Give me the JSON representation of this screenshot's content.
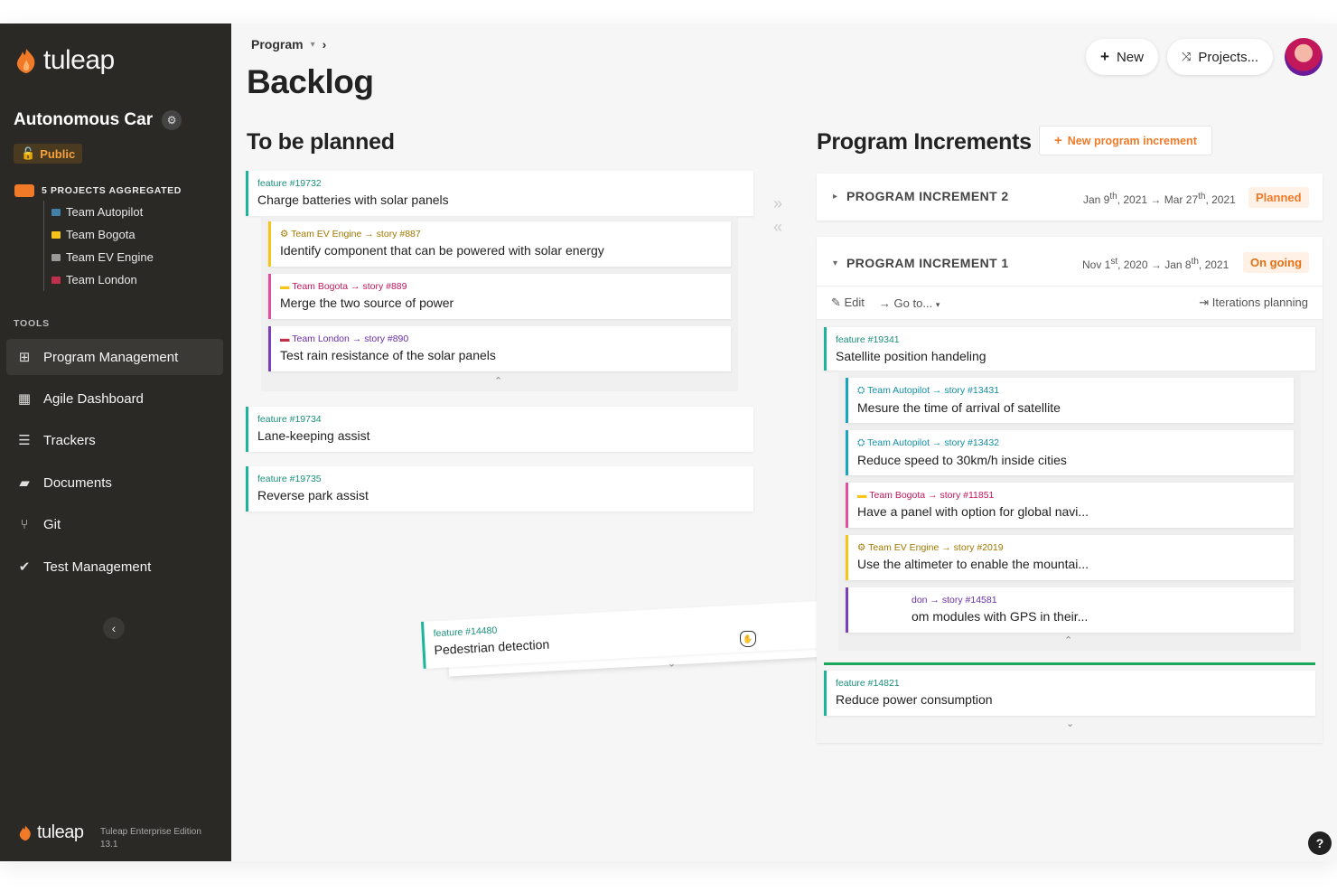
{
  "app": {
    "logo_text": "tuleap",
    "edition_line1": "Tuleap Enterprise Edition",
    "edition_line2": "13.1"
  },
  "sidebar": {
    "project_name": "Autonomous Car",
    "visibility": "Public",
    "aggregated_label": "5 PROJECTS AGGREGATED",
    "teams": [
      {
        "label": "Team Autopilot",
        "color": "#3f7fa8"
      },
      {
        "label": "Team Bogota",
        "color": "#f5c518"
      },
      {
        "label": "Team EV Engine",
        "color": "#999999"
      },
      {
        "label": "Team London",
        "color": "#c0304a"
      }
    ],
    "tools_label": "TOOLS",
    "tools": [
      {
        "label": "Program Management",
        "icon": "sitemap-icon",
        "glyph": "⊞"
      },
      {
        "label": "Agile Dashboard",
        "icon": "table-icon",
        "glyph": "▦"
      },
      {
        "label": "Trackers",
        "icon": "list-icon",
        "glyph": "☰"
      },
      {
        "label": "Documents",
        "icon": "folder-icon",
        "glyph": "▰"
      },
      {
        "label": "Git",
        "icon": "git-icon",
        "glyph": "⑂"
      },
      {
        "label": "Test Management",
        "icon": "check-icon",
        "glyph": "✔"
      }
    ]
  },
  "header": {
    "breadcrumb": "Program",
    "title": "Backlog",
    "new_button": "New",
    "projects_button": "Projects..."
  },
  "backlog": {
    "title": "To be planned",
    "features": [
      {
        "ref": "feature #19732",
        "title": "Charge batteries with solar panels",
        "stories": [
          {
            "ref": "Team EV Engine → story #887",
            "title": "Identify component that can be powered with solar energy"
          },
          {
            "ref": "Team Bogota → story #889",
            "title": "Merge the two source of power"
          },
          {
            "ref": "Team London → story #890",
            "title": "Test rain resistance of the solar panels"
          }
        ]
      },
      {
        "ref": "feature #19734",
        "title": "Lane-keeping assist"
      },
      {
        "ref": "feature #19735",
        "title": "Reverse park assist"
      }
    ],
    "dragged": {
      "ref": "feature #14480",
      "title": "Pedestrian detection"
    }
  },
  "increments": {
    "title": "Program Increments",
    "new_button": "New program increment",
    "pi2": {
      "name": "PROGRAM INCREMENT 2",
      "start": "Jan 9",
      "start_sup": "th",
      "start_year": ", 2021",
      "end": "Mar 27",
      "end_sup": "th",
      "end_year": ", 2021",
      "status": "Planned"
    },
    "pi1": {
      "name": "PROGRAM INCREMENT 1",
      "start": "Nov 1",
      "start_sup": "st",
      "start_year": ", 2020",
      "end": "Jan 8",
      "end_sup": "th",
      "end_year": ", 2021",
      "status": "On going",
      "edit": "Edit",
      "goto": "Go to...",
      "iterations": "Iterations planning",
      "feature1": {
        "ref": "feature #19341",
        "title": "Satellite position handeling",
        "stories": [
          {
            "ref": "Team Autopilot → story #13431",
            "title": "Mesure the time of arrival of satellite"
          },
          {
            "ref": "Team Autopilot → story #13432",
            "title": "Reduce speed to 30km/h inside cities"
          },
          {
            "ref": "Team Bogota → story #11851",
            "title": "Have a panel with option for global navi..."
          },
          {
            "ref": "Team EV Engine → story #2019",
            "title": "Use the altimeter to enable the mountai..."
          },
          {
            "ref": "don → story #14581",
            "title": "om modules with GPS in their..."
          }
        ]
      },
      "feature2": {
        "ref": "feature #14821",
        "title": "Reduce power consumption"
      }
    }
  },
  "help": "?"
}
